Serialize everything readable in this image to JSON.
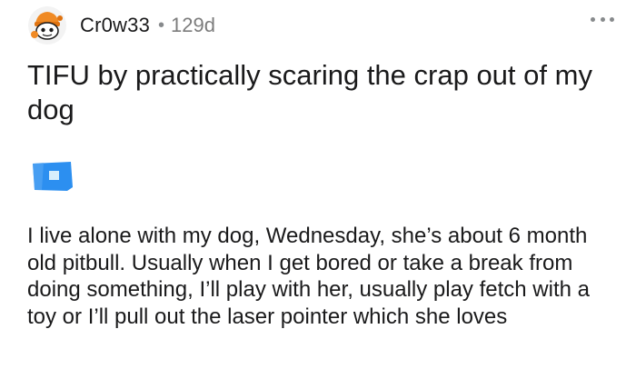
{
  "post": {
    "author": "Cr0w33",
    "separator": "•",
    "age": "129d",
    "title": "TIFU by practically scaring the crap out of my dog",
    "body": "I live alone with my dog, Wednesday, she’s about 6 month old pitbull. Usually when I get bored or take a break from doing something, I’ll play with her, usually play fetch with a toy or I’ll pull out the laser pointer which she loves"
  },
  "icons": {
    "avatar": "snoo-avatar-icon",
    "more": "more-options-icon",
    "flair": "image-placeholder-icon"
  },
  "colors": {
    "avatar_orange": "#f08a24",
    "flair_blue": "#2c8ff0",
    "muted_text": "#7c7c7c"
  }
}
